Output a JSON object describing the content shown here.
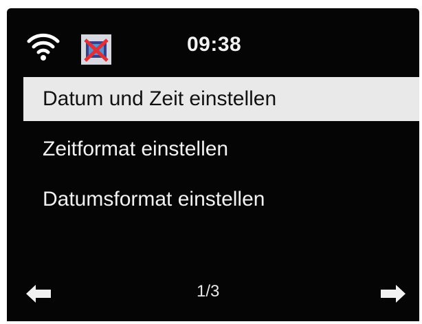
{
  "status_bar": {
    "time": "09:38",
    "wifi_icon": "wifi-icon",
    "alarm_icon": "alarm-off-icon"
  },
  "menu": {
    "selected_index": 0,
    "items": [
      {
        "label": "Datum und Zeit einstellen"
      },
      {
        "label": "Zeitformat einstellen"
      },
      {
        "label": "Datumsformat einstellen"
      }
    ]
  },
  "footer": {
    "page": "1/3",
    "prev_icon": "arrow-left-icon",
    "next_icon": "arrow-right-icon"
  },
  "colors": {
    "screen_background": "#050505",
    "text": "#f2f2f2",
    "highlight": "#e9e9ea",
    "highlight_text": "#111111"
  }
}
